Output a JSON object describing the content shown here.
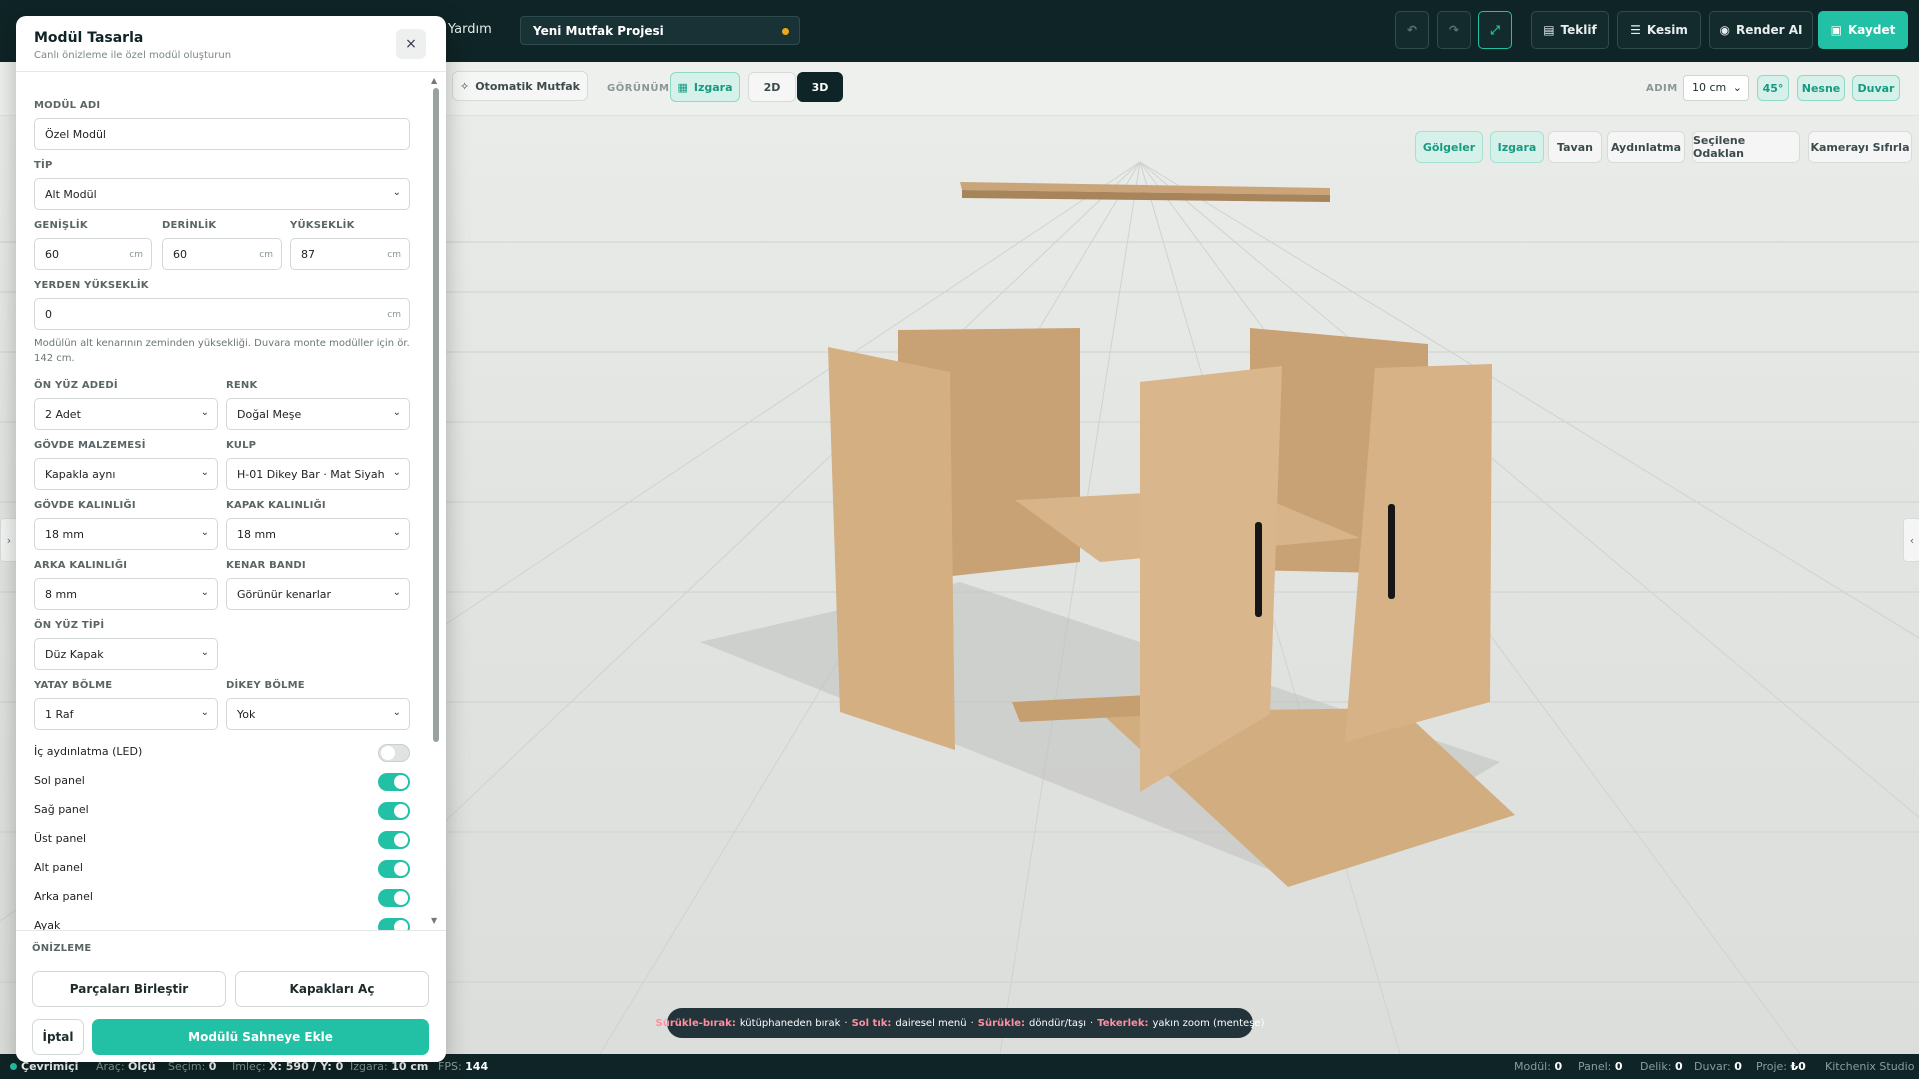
{
  "topbar": {
    "menu_help": "Yardım",
    "project_name": "Yeni Mutfak Projesi",
    "buttons": {
      "quote": "Teklif",
      "cut": "Kesim",
      "render": "Render AI",
      "save": "Kaydet"
    }
  },
  "toolbar": {
    "auto_kitchen": "Otomatik Mutfak",
    "view_label": "GÖRÜNÜM",
    "grid_btn": "Izgara",
    "view_2d": "2D",
    "view_3d": "3D",
    "step_label": "ADIM",
    "step_value": "10 cm",
    "angle": "45°",
    "object": "Nesne",
    "wall": "Duvar"
  },
  "viewport_buttons": [
    "Gölgeler",
    "Izgara",
    "Tavan",
    "Aydınlatma",
    "Seçilene Odaklan",
    "Kamerayı Sıfırla"
  ],
  "hint": {
    "k1": "Sürükle-bırak:",
    "v1": "kütüphaneden bırak",
    "k2": "Sol tık:",
    "v2": "dairesel menü",
    "k3": "Sürükle:",
    "v3": "döndür/taşı",
    "k4": "Tekerlek:",
    "v4": "yakın zoom (menteşe)",
    "sep": "·"
  },
  "panel": {
    "title": "Modül Tasarla",
    "subtitle": "Canlı önizleme ile özel modül oluşturun",
    "close": "×",
    "module_name_label": "MODÜL ADI",
    "module_name_value": "Özel Modül",
    "type_label": "TİP",
    "type_value": "Alt Modül",
    "width_label": "GENİŞLİK",
    "width_value": "60",
    "depth_label": "DERİNLİK",
    "depth_value": "60",
    "height_label": "YÜKSEKLİK",
    "height_value": "87",
    "unit": "cm",
    "floor_height_label": "YERDEN YÜKSEKLİK",
    "floor_height_value": "0",
    "floor_help": "Modülün alt kenarının zeminden yüksekliği. Duvara monte modüller için ör. 142 cm.",
    "front_count_label": "ÖN YÜZ ADEDİ",
    "front_count_value": "2 Adet",
    "color_label": "RENK",
    "color_value": "Doğal Meşe",
    "body_material_label": "GÖVDE MALZEMESİ",
    "body_material_value": "Kapakla aynı",
    "handle_label": "KULP",
    "handle_value": "H-01 Dikey Bar · Mat Siyah",
    "body_thickness_label": "GÖVDE KALINLIĞI",
    "body_thickness_value": "18 mm",
    "door_thickness_label": "KAPAK KALINLIĞI",
    "door_thickness_value": "18 mm",
    "back_thickness_label": "ARKA KALINLIĞI",
    "back_thickness_value": "8 mm",
    "edge_band_label": "KENAR BANDI",
    "edge_band_value": "Görünür kenarlar",
    "front_type_label": "ÖN YÜZ TİPİ",
    "front_type_value": "Düz Kapak",
    "hdiv_label": "YATAY BÖLME",
    "hdiv_value": "1 Raf",
    "vdiv_label": "DİKEY BÖLME",
    "vdiv_value": "Yok",
    "toggles": [
      {
        "label": "İç aydınlatma (LED)",
        "on": false
      },
      {
        "label": "Sol panel",
        "on": true
      },
      {
        "label": "Sağ panel",
        "on": true
      },
      {
        "label": "Üst panel",
        "on": true
      },
      {
        "label": "Alt panel",
        "on": true
      },
      {
        "label": "Arka panel",
        "on": true
      },
      {
        "label": "Ayak",
        "on": true
      }
    ],
    "preview_label": "ÖNİZLEME",
    "merge_btn": "Parçaları Birleştir",
    "open_doors_btn": "Kapakları Aç",
    "cancel_btn": "İptal",
    "add_btn": "Modülü Sahneye Ekle"
  },
  "status": {
    "online": "Çevrimiçi",
    "tool_label": "Araç:",
    "tool_value": "Ölçü",
    "selection_label": "Seçim:",
    "selection_value": "0",
    "cursor_label": "İmleç:",
    "cursor_value": "X: 590 / Y: 0",
    "grid_label": "Izgara:",
    "grid_value": "10 cm",
    "fps_label": "FPS:",
    "fps_value": "144",
    "module_label": "Modül:",
    "module_value": "0",
    "panel_label": "Panel:",
    "panel_value": "0",
    "hole_label": "Delik:",
    "hole_value": "0",
    "wall_label": "Duvar:",
    "wall_value": "0",
    "project_label": "Proje:",
    "project_value": "₺0",
    "brand": "Kitchenix Studio"
  }
}
